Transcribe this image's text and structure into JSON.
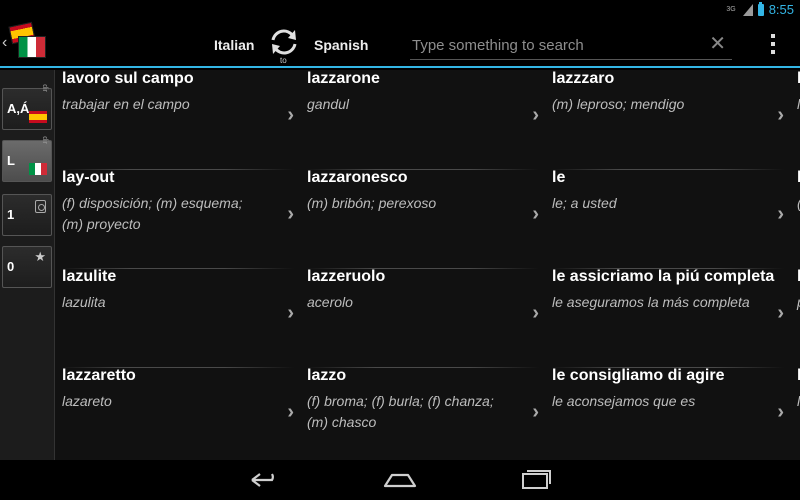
{
  "status_bar": {
    "network": "3G",
    "time": "8:55"
  },
  "action_bar": {
    "from_language": "Italian",
    "swap_label": "to",
    "to_language": "Spanish",
    "search_placeholder": "Type something to search",
    "clear_symbol": "✕"
  },
  "left_rail": {
    "items": [
      {
        "label": "A,Á",
        "tag": "dir"
      },
      {
        "label": "L",
        "tag": "dir"
      },
      {
        "label": "1"
      },
      {
        "label": "0"
      }
    ]
  },
  "entries": [
    [
      {
        "term": "lavoro sul campo",
        "translation": "trabajar en el campo"
      },
      {
        "term": "lay-out",
        "translation": "(f) disposición; (m) esquema; (m) proyecto"
      },
      {
        "term": "lazulite",
        "translation": "lazulita"
      },
      {
        "term": "lazzaretto",
        "translation": "lazareto"
      }
    ],
    [
      {
        "term": "lazzarone",
        "translation": "gandul"
      },
      {
        "term": "lazzaronesco",
        "translation": "(m) bribón; perexoso"
      },
      {
        "term": "lazzeruolo",
        "translation": "acerolo"
      },
      {
        "term": "lazzo",
        "translation": "(f) broma; (f) burla; (f) chanza; (m) chasco"
      }
    ],
    [
      {
        "term": "lazzzaro",
        "translation": "(m) leproso; mendigo"
      },
      {
        "term": "le",
        "translation": "le; a usted"
      },
      {
        "term": "le assicriamo la piú completa",
        "translation": "le aseguramos la más completa"
      },
      {
        "term": "le consigliamo di agire",
        "translation": "le aconsejamos que es"
      }
    ],
    [
      {
        "term": "l",
        "translation": "l"
      },
      {
        "term": "l",
        "translation": "("
      },
      {
        "term": "l",
        "translation": "p"
      },
      {
        "term": "l",
        "translation": "l"
      }
    ]
  ],
  "chevron": "›",
  "colors": {
    "accent": "#33b5e5",
    "background": "#111111",
    "translation_text": "#bdbdbd"
  }
}
